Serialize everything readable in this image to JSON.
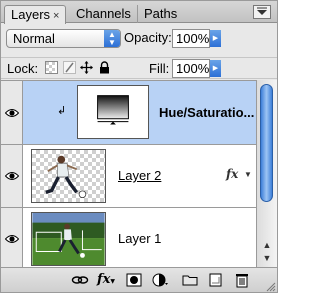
{
  "tabs": [
    {
      "label": "Layers",
      "close": "×"
    },
    {
      "label": "Channels"
    },
    {
      "label": "Paths"
    }
  ],
  "blend": {
    "mode": "Normal",
    "opacity_label": "Opacity:",
    "opacity": "100%"
  },
  "lock": {
    "label": "Lock:",
    "fill_label": "Fill:",
    "fill": "100%"
  },
  "layers": [
    {
      "name": "Hue/Saturatio...",
      "type": "adjustment",
      "selected": true,
      "visible": true
    },
    {
      "name": "Layer 2",
      "type": "pixel",
      "selected": false,
      "visible": true,
      "fx": "fx"
    },
    {
      "name": "Layer 1",
      "type": "pixel",
      "selected": false,
      "visible": true
    }
  ],
  "colors": {
    "selection": "#b8d2f5",
    "accent": "#2c6fd6"
  },
  "icons": {
    "menu": "panel-menu-icon",
    "eye": "eye-icon",
    "link": "link-layers-icon",
    "fx": "layer-style-icon",
    "mask": "add-mask-icon",
    "adjust": "new-adjustment-icon",
    "group": "new-group-icon",
    "new": "new-layer-icon",
    "trash": "trash-icon"
  },
  "toolbar": {
    "fx_label": "fx"
  }
}
